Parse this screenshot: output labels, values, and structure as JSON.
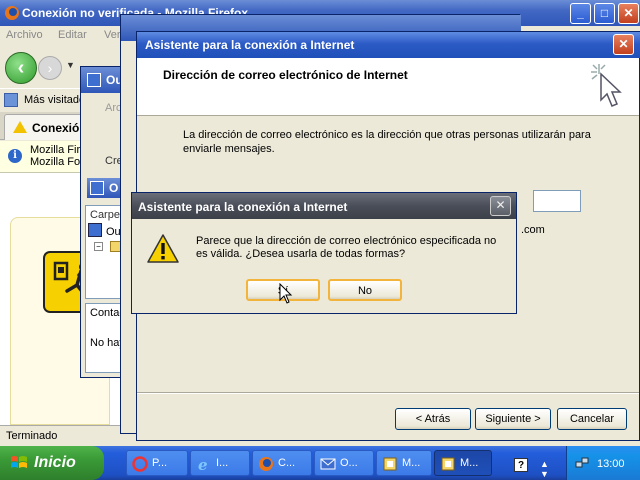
{
  "firefox": {
    "title": "Conexión no verificada - Mozilla Firefox",
    "menu": [
      "Archivo",
      "Editar",
      "Ver"
    ],
    "bookmark_label": "Más visitados",
    "tab_label": "Conexión",
    "infobar_line1": "Mozilla Fire",
    "infobar_line2": "Mozilla Fou",
    "status": "Terminado"
  },
  "outlook": {
    "title": "Ou",
    "menu_item": "Arc",
    "create_label": "Cre",
    "subwindow_title": "O",
    "folders_header": "Carpet",
    "folder_item": "Ou",
    "contacts_header": "Contac",
    "contacts_empty": "No hay"
  },
  "wizard": {
    "title": "Asistente para la conexión a Internet",
    "header_title": "Dirección de correo electrónico de Internet",
    "description": "La dirección de correo electrónico es la dirección que otras personas utilizarán para enviarle mensajes.",
    "email_value": "",
    "domain_suffix": ".com",
    "back_button": "< Atrás",
    "next_button": "Siguiente >",
    "cancel_button": "Cancelar"
  },
  "dialog": {
    "title": "Asistente para la conexión a Internet",
    "message": "Parece que la dirección de correo electrónico especificada no es válida. ¿Desea usarla de todas formas?",
    "yes_button": "Sí",
    "no_button": "No"
  },
  "taskbar": {
    "start_label": "Inicio",
    "buttons": [
      "P...",
      "I...",
      "C...",
      "O...",
      "M...",
      "M..."
    ],
    "clock": "13:00"
  },
  "colors": {
    "xp_blue": "#2f57b8",
    "start_green": "#3a9a36",
    "warning_yellow": "#f6d000",
    "dialog_title_gray": "#4a4e58"
  }
}
